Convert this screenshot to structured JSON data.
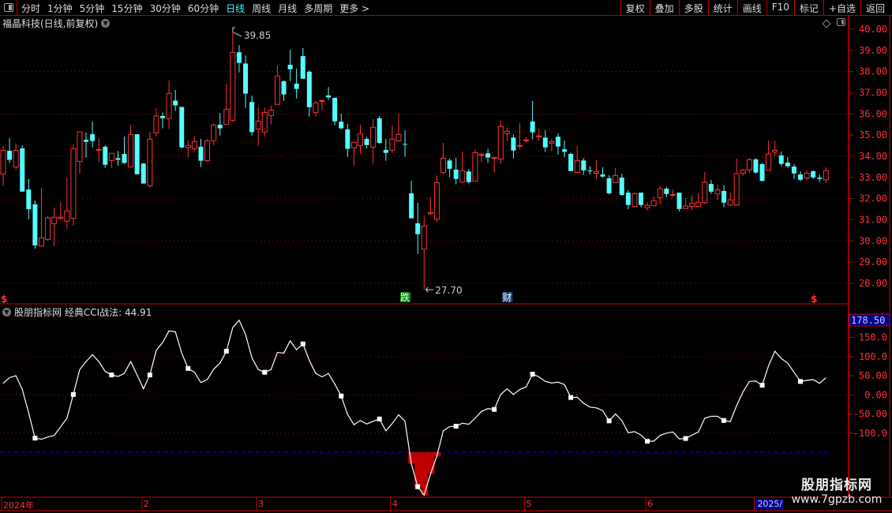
{
  "toolbar": {
    "periods": [
      "分时",
      "1分钟",
      "5分钟",
      "15分钟",
      "30分钟",
      "60分钟",
      "日线",
      "周线",
      "月线",
      "多周期",
      "更多 >"
    ],
    "active_period": "日线",
    "buttons": [
      "复权",
      "叠加",
      "多股",
      "统计",
      "画线",
      "F10",
      "标记",
      "+自选",
      "返回"
    ]
  },
  "main_title": "福晶科技(日线,前复权)",
  "indicator_title": "股朋指标网 经典CCI战法: 44.91",
  "watermark": {
    "line1": "股朋指标网",
    "line2": "www.7gpzb.com"
  },
  "colors": {
    "up": "#ff3333",
    "down": "#54ffff",
    "axis": "#cc0000",
    "grid": "#8b1a1a",
    "cci_line": "#ffffff",
    "signal_bar": "#bb0000",
    "threshold_line": "#0000ff"
  },
  "chart_data": [
    {
      "type": "candlestick",
      "title": "福晶科技(日线,前复权)",
      "ylim": [
        27.5,
        40.1
      ],
      "y_ticks": [
        "40.00",
        "39.00",
        "38.00",
        "37.00",
        "36.00",
        "35.00",
        "34.00",
        "33.00",
        "32.00",
        "31.00",
        "30.00",
        "29.00",
        "28.00"
      ],
      "grid_values": [
        38,
        36,
        34,
        32,
        30,
        28
      ],
      "x_ticks": [
        {
          "index": 0,
          "label": "2024年"
        },
        {
          "index": 22,
          "label": "2"
        },
        {
          "index": 40,
          "label": "3"
        },
        {
          "index": 61,
          "label": "4"
        },
        {
          "index": 82,
          "label": "5"
        },
        {
          "index": 101,
          "label": "6"
        },
        {
          "index": 118,
          "label": "2025/",
          "highlight": true
        }
      ],
      "annotations": [
        {
          "index": 36,
          "label": "39.85",
          "type": "high"
        },
        {
          "index": 66,
          "label": "27.70",
          "type": "low"
        },
        {
          "index": 63,
          "label": "跌",
          "color": "#008800"
        },
        {
          "index": 79,
          "label": "财",
          "color": "#1a3f7a"
        },
        {
          "index": 0,
          "label": "$",
          "color": "#ff3333"
        },
        {
          "index": 127,
          "label": "$",
          "color": "#ff3333"
        }
      ],
      "ohlc_columns": [
        "open",
        "high",
        "low",
        "close"
      ],
      "ohlc": [
        [
          33.17,
          34.48,
          32.6,
          34.28
        ],
        [
          34.26,
          34.86,
          33.68,
          33.83
        ],
        [
          33.49,
          34.58,
          33.37,
          34.28
        ],
        [
          34.37,
          34.52,
          32.33,
          32.33
        ],
        [
          32.43,
          32.92,
          31.03,
          31.5
        ],
        [
          31.73,
          31.91,
          29.64,
          29.79
        ],
        [
          29.76,
          32.51,
          29.76,
          30.15
        ],
        [
          30.07,
          31.17,
          30.0,
          31.09
        ],
        [
          30.82,
          31.58,
          29.76,
          31.12
        ],
        [
          31.07,
          31.84,
          30.99,
          31.12
        ],
        [
          30.93,
          32.99,
          30.58,
          31.42
        ],
        [
          31.07,
          34.56,
          30.73,
          34.36
        ],
        [
          33.76,
          35.15,
          33.19,
          35.15
        ],
        [
          34.78,
          35.12,
          33.94,
          34.68
        ],
        [
          35.04,
          35.64,
          34.42,
          34.72
        ],
        [
          34.3,
          34.86,
          33.74,
          34.32
        ],
        [
          34.45,
          34.52,
          33.45,
          33.6
        ],
        [
          33.8,
          34.14,
          33.45,
          34.14
        ],
        [
          33.91,
          34.25,
          33.56,
          33.83
        ],
        [
          34.11,
          34.93,
          33.64,
          33.68
        ],
        [
          33.49,
          35.49,
          33.49,
          35.03
        ],
        [
          35.04,
          35.04,
          33.15,
          33.15
        ],
        [
          33.66,
          33.66,
          32.71,
          32.71
        ],
        [
          32.61,
          35.15,
          32.53,
          34.81
        ],
        [
          35.1,
          36.26,
          34.94,
          35.9
        ],
        [
          35.9,
          36.07,
          35.32,
          35.8
        ],
        [
          35.78,
          37.58,
          35.28,
          36.97
        ],
        [
          36.63,
          37.13,
          36.14,
          36.4
        ],
        [
          36.33,
          36.33,
          34.38,
          34.42
        ],
        [
          34.4,
          34.75,
          33.94,
          34.51
        ],
        [
          34.36,
          34.97,
          34.24,
          34.7
        ],
        [
          34.45,
          34.82,
          33.49,
          33.79
        ],
        [
          33.79,
          34.82,
          33.75,
          34.73
        ],
        [
          34.73,
          35.55,
          34.53,
          35.48
        ],
        [
          35.49,
          36.04,
          34.98,
          35.32
        ],
        [
          35.51,
          37.42,
          35.51,
          36.22
        ],
        [
          35.7,
          39.85,
          35.63,
          38.91
        ],
        [
          38.91,
          39.25,
          37.96,
          38.41
        ],
        [
          38.38,
          38.76,
          36.29,
          36.96
        ],
        [
          36.56,
          36.86,
          34.98,
          35.14
        ],
        [
          35.29,
          36.3,
          34.5,
          35.66
        ],
        [
          35.14,
          36.3,
          34.92,
          36.07
        ],
        [
          35.92,
          36.41,
          35.5,
          36.18
        ],
        [
          36.45,
          38.29,
          36.45,
          37.79
        ],
        [
          37.54,
          37.58,
          36.62,
          36.92
        ],
        [
          38.32,
          39.03,
          37.55,
          38.11
        ],
        [
          37.43,
          38.14,
          36.73,
          37.18
        ],
        [
          38.73,
          39.11,
          37.66,
          37.66
        ],
        [
          37.99,
          38.06,
          35.88,
          36.32
        ],
        [
          36.07,
          36.63,
          35.88,
          36.52
        ],
        [
          36.6,
          36.68,
          36.17,
          36.63
        ],
        [
          36.87,
          37.27,
          36.67,
          36.78
        ],
        [
          36.76,
          36.76,
          35.47,
          35.65
        ],
        [
          35.63,
          36.01,
          35.27,
          35.32
        ],
        [
          35.27,
          35.53,
          33.97,
          34.35
        ],
        [
          34.4,
          34.66,
          33.56,
          34.66
        ],
        [
          34.5,
          35.49,
          34.12,
          35.07
        ],
        [
          34.82,
          34.92,
          34.38,
          34.53
        ],
        [
          34.43,
          35.75,
          33.64,
          35.37
        ],
        [
          35.79,
          35.9,
          34.6,
          34.63
        ],
        [
          34.3,
          34.82,
          33.79,
          34.16
        ],
        [
          34.29,
          35.45,
          34.16,
          34.81
        ],
        [
          34.72,
          36.01,
          34.68,
          35.03
        ],
        [
          34.58,
          35.22,
          33.97,
          34.56
        ],
        [
          32.25,
          32.84,
          31.07,
          31.07
        ],
        [
          30.83,
          31.8,
          29.39,
          30.32
        ],
        [
          29.61,
          31.2,
          27.7,
          30.71
        ],
        [
          31.29,
          32.06,
          31.22,
          31.34
        ],
        [
          31.03,
          33.1,
          30.88,
          32.75
        ],
        [
          33.23,
          34.63,
          33.12,
          33.91
        ],
        [
          33.8,
          33.89,
          33.01,
          33.41
        ],
        [
          33.37,
          33.93,
          32.67,
          32.93
        ],
        [
          32.78,
          34.22,
          32.74,
          33.32
        ],
        [
          33.28,
          33.4,
          32.71,
          32.78
        ],
        [
          32.82,
          34.32,
          32.82,
          34.17
        ],
        [
          34.06,
          34.17,
          33.71,
          34.08
        ],
        [
          34.14,
          34.36,
          33.68,
          33.94
        ],
        [
          33.91,
          33.94,
          33.23,
          33.94
        ],
        [
          33.86,
          35.68,
          33.64,
          35.4
        ],
        [
          35.07,
          35.37,
          34.72,
          35.18
        ],
        [
          34.88,
          35.03,
          33.9,
          34.27
        ],
        [
          34.48,
          35.56,
          34.35,
          34.51
        ],
        [
          34.74,
          34.92,
          34.64,
          34.77
        ],
        [
          35.64,
          36.61,
          34.79,
          35.13
        ],
        [
          34.92,
          35.3,
          34.72,
          34.96
        ],
        [
          34.88,
          35.23,
          34.2,
          34.42
        ],
        [
          34.62,
          34.82,
          34.24,
          34.69
        ],
        [
          34.92,
          35.08,
          34.08,
          34.46
        ],
        [
          34.33,
          34.74,
          33.95,
          34.21
        ],
        [
          34.11,
          34.17,
          33.3,
          33.3
        ],
        [
          33.24,
          34.48,
          33.18,
          33.8
        ],
        [
          33.8,
          33.92,
          33.12,
          33.33
        ],
        [
          33.33,
          33.52,
          33.14,
          33.3
        ],
        [
          33.2,
          33.81,
          32.93,
          33.28
        ],
        [
          33.14,
          33.48,
          33.0,
          33.04
        ],
        [
          32.96,
          33.1,
          32.21,
          32.25
        ],
        [
          32.75,
          33.44,
          32.75,
          33.09
        ],
        [
          32.99,
          33.18,
          32.15,
          32.17
        ],
        [
          32.28,
          32.4,
          31.5,
          31.7
        ],
        [
          31.63,
          32.31,
          31.63,
          32.23
        ],
        [
          32.28,
          32.28,
          31.59,
          31.7
        ],
        [
          31.57,
          31.83,
          31.44,
          31.68
        ],
        [
          31.66,
          32.1,
          31.66,
          31.9
        ],
        [
          32.04,
          32.58,
          31.74,
          32.46
        ],
        [
          32.47,
          32.55,
          32.07,
          32.22
        ],
        [
          32.16,
          32.43,
          32.07,
          32.2
        ],
        [
          32.28,
          32.28,
          31.4,
          31.51
        ],
        [
          31.53,
          32.01,
          31.53,
          31.65
        ],
        [
          31.63,
          32.16,
          31.44,
          31.79
        ],
        [
          31.63,
          32.25,
          31.59,
          31.83
        ],
        [
          31.81,
          33.25,
          31.74,
          32.77
        ],
        [
          32.69,
          32.88,
          32.22,
          32.33
        ],
        [
          32.22,
          32.66,
          31.92,
          32.42
        ],
        [
          32.36,
          32.62,
          31.59,
          31.81
        ],
        [
          31.7,
          32.28,
          31.66,
          31.94
        ],
        [
          31.7,
          33.89,
          31.66,
          33.17
        ],
        [
          33.2,
          33.4,
          33.08,
          33.35
        ],
        [
          33.35,
          33.92,
          33.22,
          33.84
        ],
        [
          33.85,
          33.92,
          33.18,
          33.23
        ],
        [
          33.63,
          33.68,
          32.81,
          32.84
        ],
        [
          33.34,
          34.74,
          33.34,
          34.1
        ],
        [
          34.2,
          34.74,
          34.01,
          34.28
        ],
        [
          34.04,
          34.22,
          33.53,
          33.64
        ],
        [
          33.7,
          33.96,
          33.45,
          33.53
        ],
        [
          33.51,
          33.63,
          32.93,
          33.19
        ],
        [
          33.14,
          33.29,
          32.82,
          32.89
        ],
        [
          32.97,
          33.32,
          32.85,
          33.2
        ],
        [
          33.29,
          33.33,
          32.93,
          33.0
        ],
        [
          32.99,
          33.14,
          32.78,
          32.93
        ],
        [
          32.89,
          33.48,
          32.74,
          33.32
        ]
      ]
    },
    {
      "type": "line",
      "title": "股朋指标网 经典CCI战法",
      "series": [
        {
          "name": "经典CCI战法",
          "current": 44.91
        }
      ],
      "ylim": [
        -270,
        200
      ],
      "current_value_label": "178.50",
      "y_ticks": [
        "150.0",
        "100.0",
        "50.00",
        "0.00",
        "-50.00",
        "-100.0"
      ],
      "tick_values": [
        150,
        100,
        50,
        0,
        -50,
        -100
      ],
      "grid_values": [
        100,
        0,
        -100
      ],
      "threshold": -150,
      "signal": "bars where CCI < -150",
      "values": [
        30,
        45,
        50,
        14,
        -47,
        -113,
        -116,
        -110,
        -106,
        -84,
        -61,
        1,
        66,
        87,
        105,
        87,
        61,
        52,
        48,
        56,
        87,
        52,
        16,
        52,
        116,
        137,
        167,
        165,
        109,
        69,
        59,
        32,
        40,
        67,
        83,
        114,
        176,
        195,
        158,
        97,
        66,
        59,
        66,
        111,
        109,
        141,
        118,
        133,
        90,
        56,
        47,
        56,
        28,
        -3,
        -51,
        -78,
        -67,
        -76,
        -69,
        -63,
        -94,
        -75,
        -52,
        -69,
        -180,
        -240,
        -262,
        -207,
        -160,
        -94,
        -83,
        -82,
        -74,
        -77,
        -61,
        -43,
        -36,
        -38,
        1,
        16,
        1,
        14,
        21,
        54,
        47,
        35,
        31,
        33,
        27,
        -7,
        -6,
        -22,
        -32,
        -34,
        -41,
        -68,
        -50,
        -67,
        -99,
        -96,
        -105,
        -121,
        -121,
        -106,
        -100,
        -97,
        -115,
        -114,
        -105,
        -97,
        -61,
        -56,
        -56,
        -67,
        -70,
        -28,
        8,
        35,
        36,
        25,
        76,
        114,
        95,
        83,
        59,
        35,
        38,
        40,
        30,
        44.91
      ]
    }
  ]
}
